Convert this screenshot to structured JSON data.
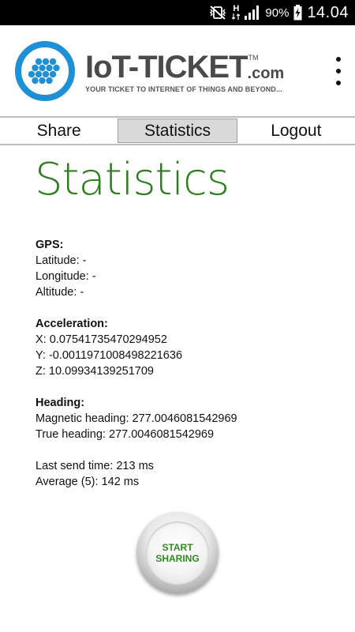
{
  "status_bar": {
    "network_type": "H",
    "battery_percent": "90%",
    "time": "14.04",
    "icons": [
      "vibrate-mute-icon",
      "network-h-icon",
      "signal-icon",
      "battery-charging-icon"
    ]
  },
  "header": {
    "brand_name": "IoT-TICKET",
    "brand_tm": "TM",
    "brand_com": ".com",
    "tagline": "YOUR TICKET TO INTERNET OF THINGS AND BEYOND...",
    "logo_color": "#1e90d6",
    "menu_icon": "more-vert-icon"
  },
  "tabs": [
    {
      "label": "Share",
      "active": false
    },
    {
      "label": "Statistics",
      "active": true
    },
    {
      "label": "Logout",
      "active": false
    }
  ],
  "page_title": "Statistics",
  "stats": {
    "gps": {
      "heading": "GPS:",
      "latitude_label": "Latitude:",
      "latitude_value": "-",
      "longitude_label": "Longitude:",
      "longitude_value": "-",
      "altitude_label": "Altitude:",
      "altitude_value": "-"
    },
    "acceleration": {
      "heading": "Acceleration:",
      "x_label": "X:",
      "x_value": "0.07541735470294952",
      "y_label": "Y:",
      "y_value": "-0.0011971008498221636",
      "z_label": "Z:",
      "z_value": "10.09934139251709"
    },
    "heading_section": {
      "heading": "Heading:",
      "magnetic_label": "Magnetic heading:",
      "magnetic_value": "277.0046081542969",
      "true_label": "True heading:",
      "true_value": "277.0046081542969"
    },
    "timing": {
      "last_send_label": "Last send time:",
      "last_send_value": "213 ms",
      "average_label": "Average (5):",
      "average_value": "142 ms"
    }
  },
  "share_button": {
    "line1": "START",
    "line2": "SHARING",
    "text_color": "#2e8b1f"
  },
  "colors": {
    "title_green": "#2e7d1f",
    "active_tab_bg": "#d9d9d9",
    "brand_blue": "#1e90d6"
  }
}
